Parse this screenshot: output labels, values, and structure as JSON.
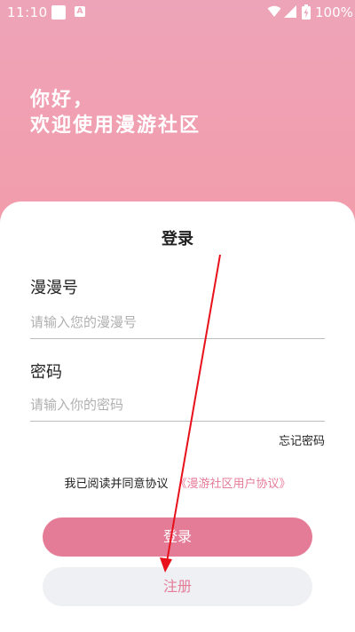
{
  "status": {
    "time": "11:10",
    "battery": "100%"
  },
  "greeting": {
    "line1": "你好，",
    "line2": "欢迎使用漫游社区"
  },
  "login": {
    "title": "登录",
    "account_label": "漫漫号",
    "account_placeholder": "请输入您的漫漫号",
    "password_label": "密码",
    "password_placeholder": "请输入你的密码",
    "forgot": "忘记密码",
    "agree_text": "我已阅读并同意协议",
    "agree_link": "《漫游社区用户协议》",
    "login_button": "登录",
    "register_button": "注册"
  },
  "colors": {
    "accent": "#e47c97",
    "annotation": "#e8101a"
  }
}
